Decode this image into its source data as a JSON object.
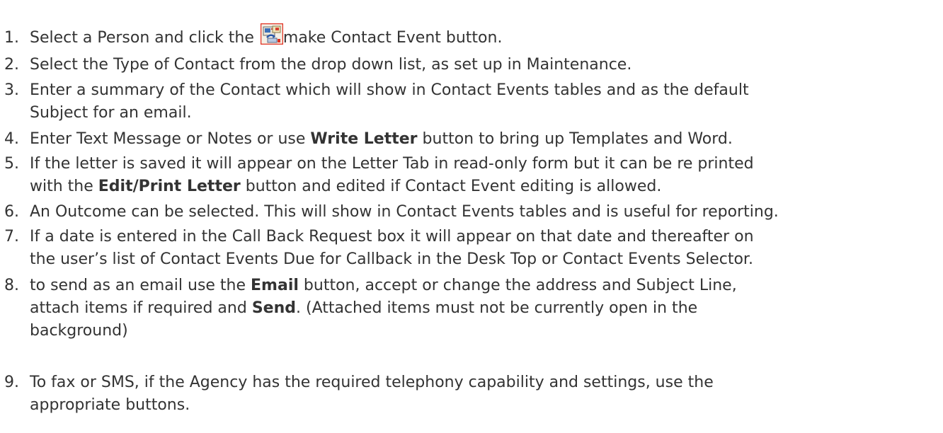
{
  "steps": [
    {
      "num": "1.",
      "before": "Select a Person and click the ",
      "icon": "contact-event-icon",
      "after": "make Contact Event button."
    },
    {
      "num": "2.",
      "text": "Select the Type of Contact from the drop down list, as set up in Maintenance."
    },
    {
      "num": "3.",
      "line1": "Enter a summary of the Contact which will show in Contact Events tables and as the default",
      "line2": "Subject for an email."
    },
    {
      "num": "4.",
      "before": "Enter Text Message or Notes or use ",
      "bold": "Write Letter",
      "after": " button to bring up Templates and Word."
    },
    {
      "num": "5.",
      "line1": "If the letter is saved it will appear on the Letter Tab in read-only form but it can be re printed",
      "line2_before": "with the ",
      "line2_bold": "Edit/Print Letter",
      "line2_after": " button and edited if Contact Event editing is allowed."
    },
    {
      "num": "6.",
      "text": "An Outcome can be selected. This will show in Contact Events tables and is useful for reporting."
    },
    {
      "num": "7.",
      "line1": "If a date is entered in the Call Back Request box it will appear on that date and thereafter on",
      "line2": "the user’s list of Contact Events Due for Callback in the Desk Top or Contact Events Selector."
    },
    {
      "num": "8.",
      "line1_before": "to send as an email use the ",
      "line1_bold": "Email",
      "line1_after": " button, accept or change the address and Subject Line,",
      "line2_before": "attach items if required and ",
      "line2_bold": "Send",
      "line2_after": ". (Attached items must not be currently open in the",
      "line3": "background)"
    },
    {
      "num": "9.",
      "line1": "To fax or SMS, if the Agency has the required telephony capability and settings, use the",
      "line2": "appropriate buttons."
    }
  ]
}
